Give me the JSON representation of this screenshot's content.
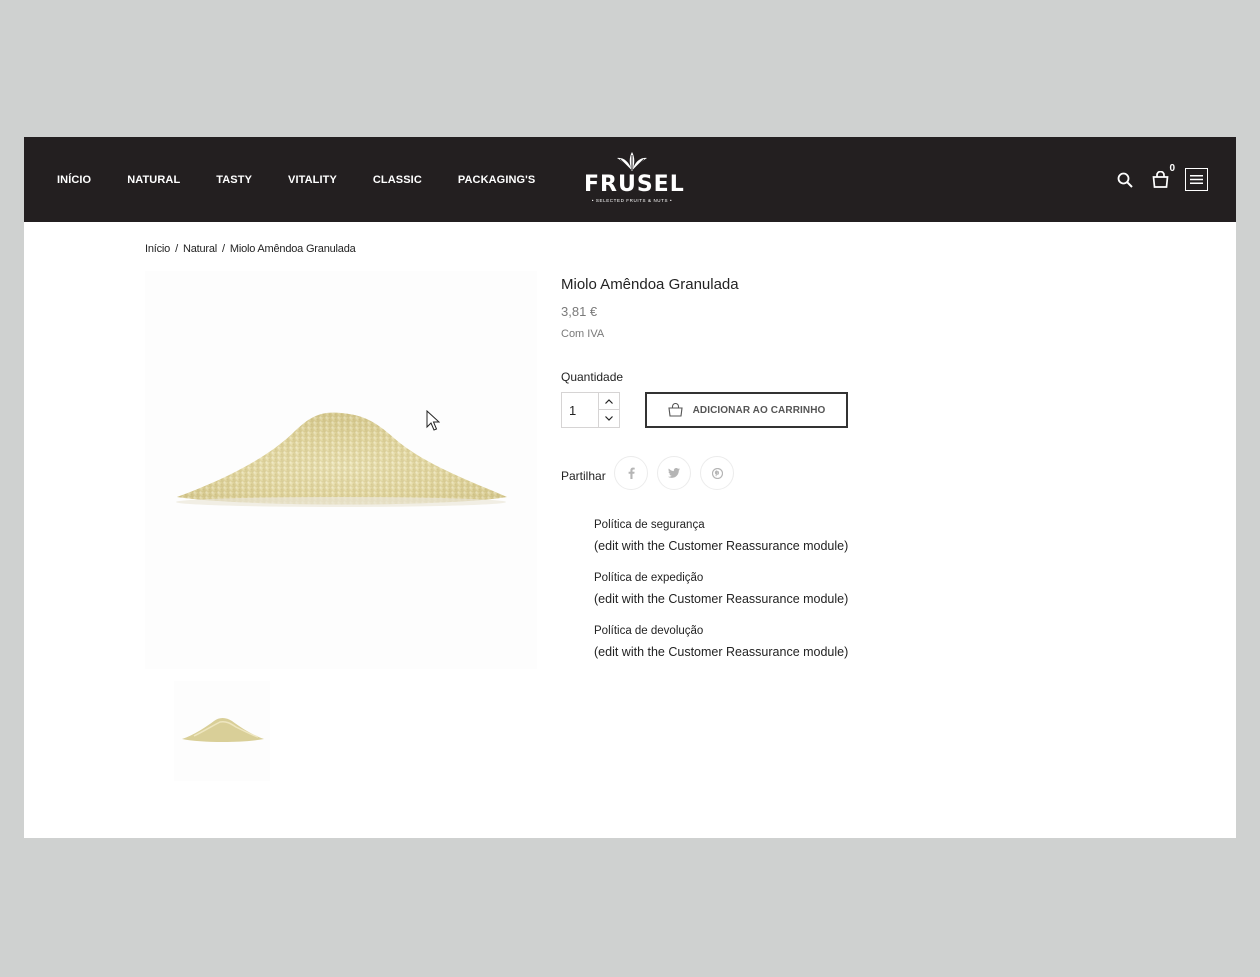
{
  "header": {
    "nav": [
      "INÍCIO",
      "NATURAL",
      "TASTY",
      "VITALITY",
      "CLASSIC",
      "PACKAGING'S"
    ],
    "logo": {
      "name": "FRUSEL",
      "tagline": "• SELECTED FRUITS & NUTS •"
    },
    "cart_count": "0",
    "icons": [
      "search-icon",
      "cart-icon",
      "menu-icon"
    ]
  },
  "breadcrumb": {
    "home": "Início",
    "category": "Natural",
    "current": "Miolo Amêndoa Granulada",
    "separator": "/"
  },
  "product": {
    "title": "Miolo Amêndoa Granulada",
    "price": "3,81 €",
    "tax_label": "Com IVA",
    "quantity_label": "Quantidade",
    "quantity": "1",
    "add_to_cart": "ADICIONAR AO CARRINHO",
    "share_label": "Partilhar",
    "share_icons": [
      "facebook-icon",
      "twitter-icon",
      "pinterest-icon"
    ]
  },
  "reassurance": [
    {
      "title": "Política de segurança",
      "desc": "(edit with the Customer Reassurance module)"
    },
    {
      "title": "Política de expedição",
      "desc": "(edit with the Customer Reassurance module)"
    },
    {
      "title": "Política de devolução",
      "desc": "(edit with the Customer Reassurance module)"
    }
  ],
  "colors": {
    "background": "#cfd1d0",
    "header": "#231f20",
    "page": "#ffffff",
    "text": "#232323",
    "muted": "#7a7a7a",
    "almond": "#e3d9a8"
  }
}
